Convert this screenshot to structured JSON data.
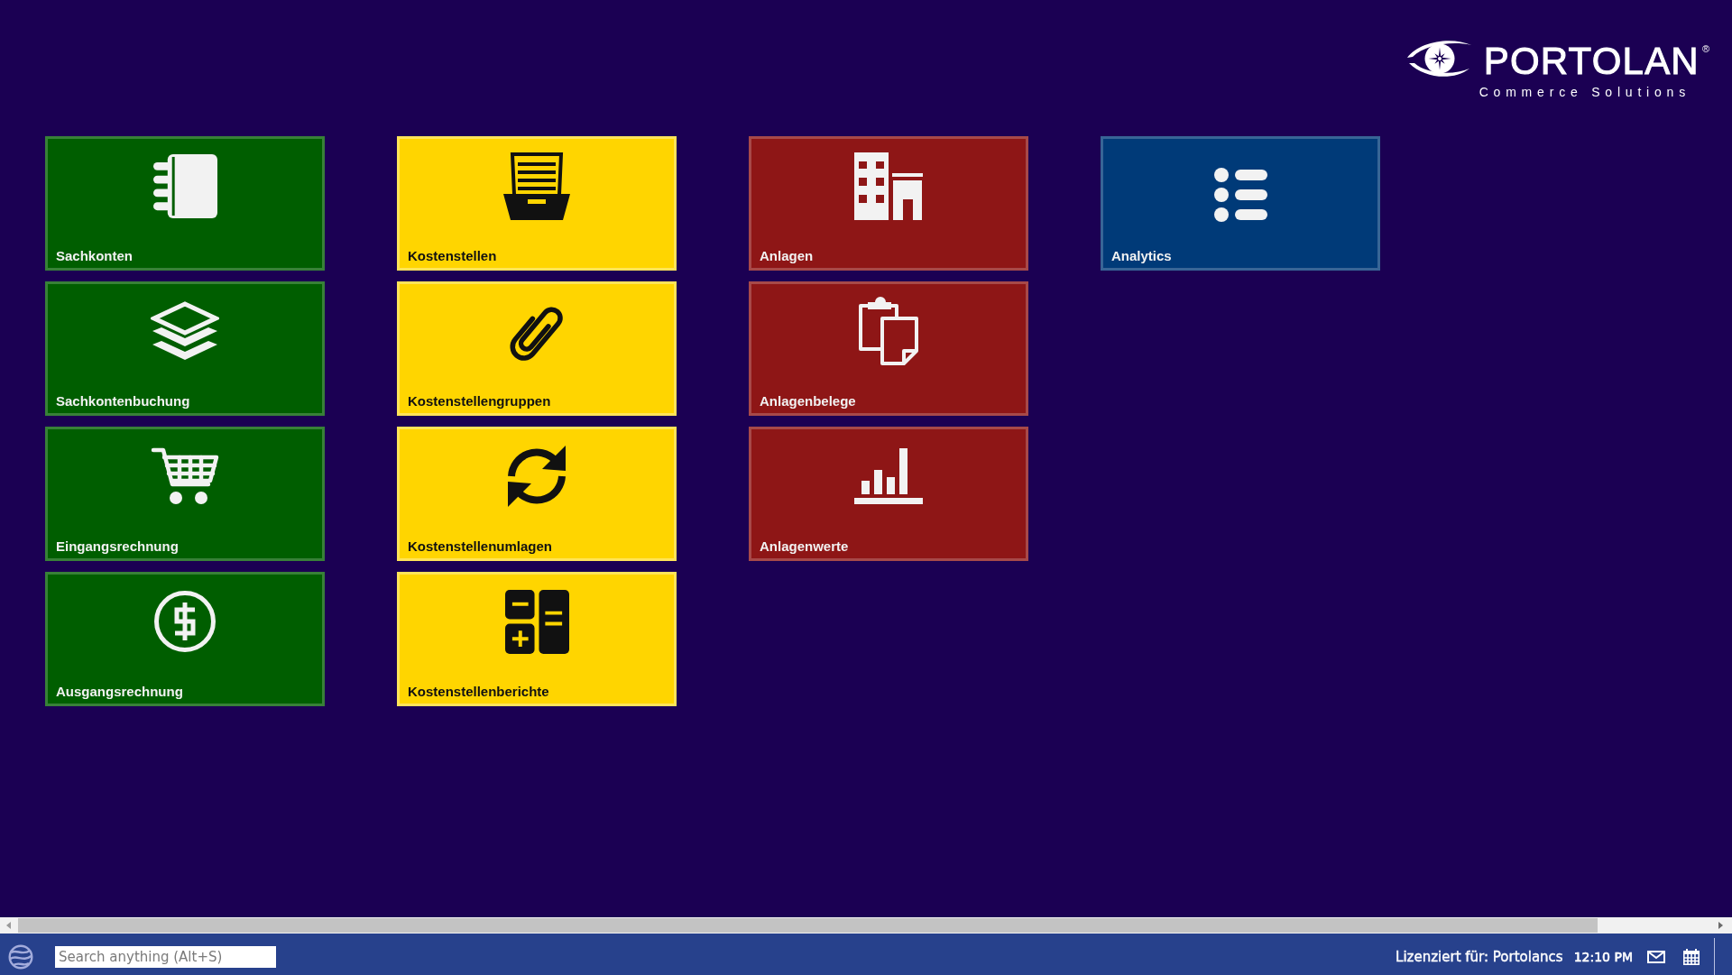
{
  "logo": {
    "wordmark": "PORTOLAN",
    "registered_mark": "®",
    "tagline": "Commerce Solutions"
  },
  "tile_columns": [
    {
      "tiles": [
        {
          "label": "Sachkonten",
          "color": "#005e00"
        },
        {
          "label": "Sachkontenbuchung",
          "color": "#005e00"
        },
        {
          "label": "Eingangsrechnung",
          "color": "#005e00"
        },
        {
          "label": "Ausgangsrechnung",
          "color": "#005e00"
        }
      ]
    },
    {
      "tiles": [
        {
          "label": "Kostenstellen",
          "color": "#ffd500"
        },
        {
          "label": "Kostenstellengruppen",
          "color": "#ffd500"
        },
        {
          "label": "Kostenstellenumlagen",
          "color": "#ffd500"
        },
        {
          "label": "Kostenstellenberichte",
          "color": "#ffd500"
        }
      ]
    },
    {
      "tiles": [
        {
          "label": "Anlagen",
          "color": "#8e1616"
        },
        {
          "label": "Anlagenbelege",
          "color": "#8e1616"
        },
        {
          "label": "Anlagenwerte",
          "color": "#8e1616"
        }
      ]
    },
    {
      "tiles": [
        {
          "label": "Analytics",
          "color": "#003a78"
        }
      ]
    }
  ],
  "taskbar": {
    "search": {
      "placeholder": "Search anything (Alt+S)"
    },
    "license": "Lizenziert für: Portolancs",
    "clock": "12:10 PM"
  }
}
